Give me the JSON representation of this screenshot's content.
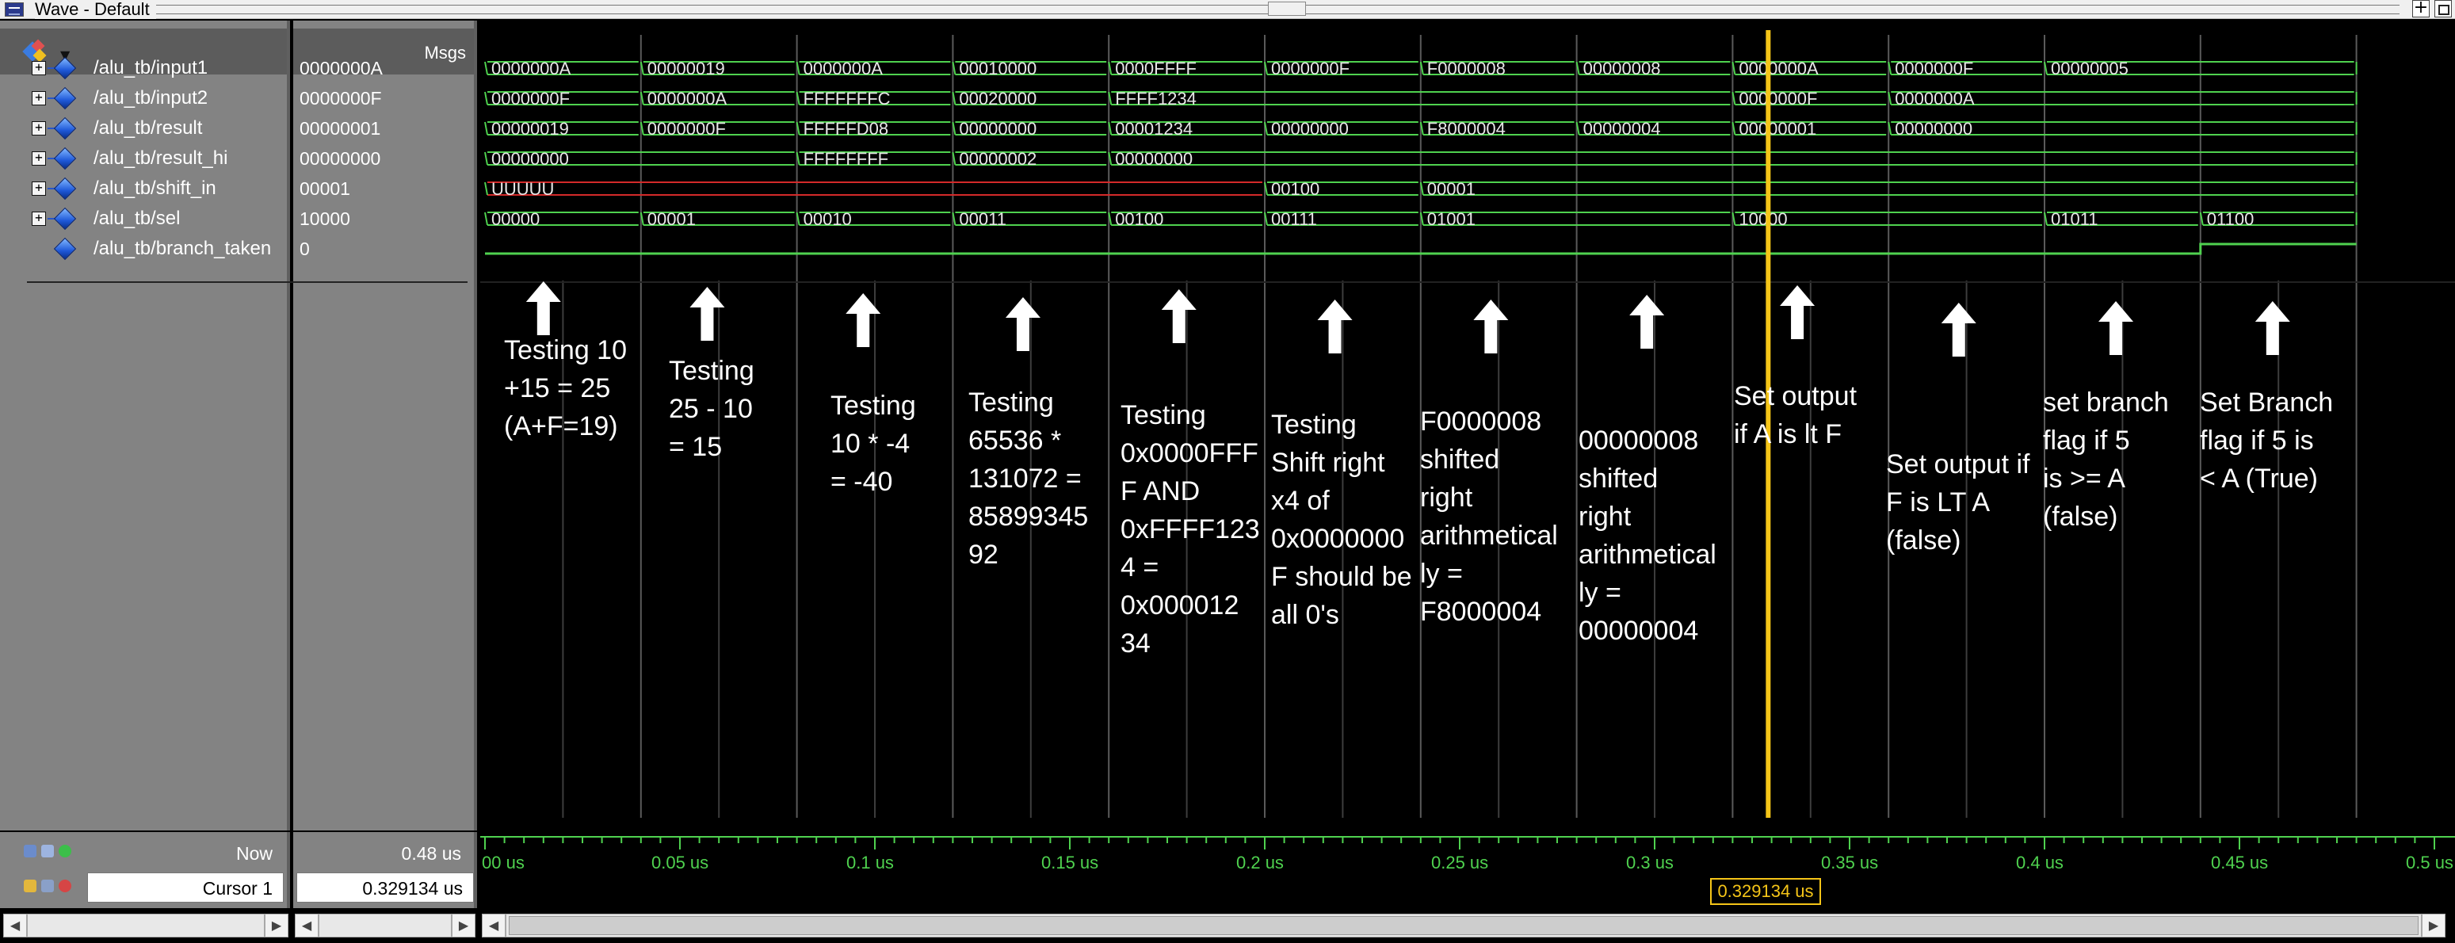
{
  "window": {
    "title": "Wave - Default"
  },
  "header": {
    "msgs_label": "Msgs"
  },
  "signals": [
    {
      "name": "/alu_tb/input1",
      "value": "0000000A",
      "expandable": true,
      "segments": [
        "0000000A",
        "00000019",
        "0000000A",
        "00010000",
        "0000FFFF",
        "0000000F",
        "F0000008",
        "00000008",
        "0000000A",
        "0000000F",
        "00000005"
      ]
    },
    {
      "name": "/alu_tb/input2",
      "value": "0000000F",
      "expandable": true,
      "segments": [
        "0000000F",
        "0000000A",
        "FFFFFFFC",
        "00020000",
        "FFFF1234",
        "0000000F",
        "0000000A"
      ]
    },
    {
      "name": "/alu_tb/result",
      "value": "00000001",
      "expandable": true,
      "segments": [
        "00000019",
        "0000000F",
        "FFFFFD08",
        "00000000",
        "00001234",
        "00000000",
        "F8000004",
        "00000004",
        "00000001",
        "00000000"
      ]
    },
    {
      "name": "/alu_tb/result_hi",
      "value": "00000000",
      "expandable": true,
      "segments": [
        "00000000",
        "FFFFFFFF",
        "00000002",
        "00000000"
      ]
    },
    {
      "name": "/alu_tb/shift_in",
      "value": "00001",
      "expandable": true,
      "segments": [
        "UUUUU",
        "00100",
        "00001"
      ]
    },
    {
      "name": "/alu_tb/sel",
      "value": "10000",
      "expandable": true,
      "segments": [
        "00000",
        "00001",
        "00010",
        "00011",
        "00100",
        "00111",
        "01001",
        "10000",
        "01011",
        "01100"
      ]
    },
    {
      "name": "/alu_tb/branch_taken",
      "value": "0",
      "expandable": false,
      "segments": []
    }
  ],
  "annotations": [
    "Testing 10\n+15 = 25\n(A+F=19)",
    "Testing\n25 - 10\n= 15",
    "Testing\n10 * -4\n= -40",
    "Testing\n65536 *\n131072 =\n85899345\n92",
    "Testing\n0x0000FFF\nF AND\n0xFFFF123\n4 =\n0x000012\n34",
    "Testing\nShift right\nx4 of\n0x0000000\nF should be\nall 0's",
    "F0000008\nshifted\nright\narithmetical\nly =\nF8000004",
    "00000008\nshifted\nright\narithmetical\nly =\n00000004",
    "Set output\nif A is lt F",
    "Set output if\nF is LT A\n(false)",
    "set branch\nflag if 5\nis >= A\n(false)",
    "Set Branch\nflag if 5 is\n< A (True)"
  ],
  "status": {
    "now_label": "Now",
    "now_value": "0.48 us",
    "cursor_label": "Cursor 1",
    "cursor_value": "0.329134 us",
    "cursor_time_tag": "0.329134 us"
  },
  "time_axis": {
    "labels": [
      "00 us",
      "0.05 us",
      "0.1 us",
      "0.15 us",
      "0.2 us",
      "0.25 us",
      "0.3 us",
      "0.35 us",
      "0.4 us",
      "0.45 us",
      "0.5 us"
    ]
  },
  "colors": {
    "wave": "#4fd24f",
    "wave_undefined": "#d42a2a",
    "cursor": "#f5c518",
    "wave_text": "#e8e8e8",
    "grid": "#5a5a5a"
  }
}
